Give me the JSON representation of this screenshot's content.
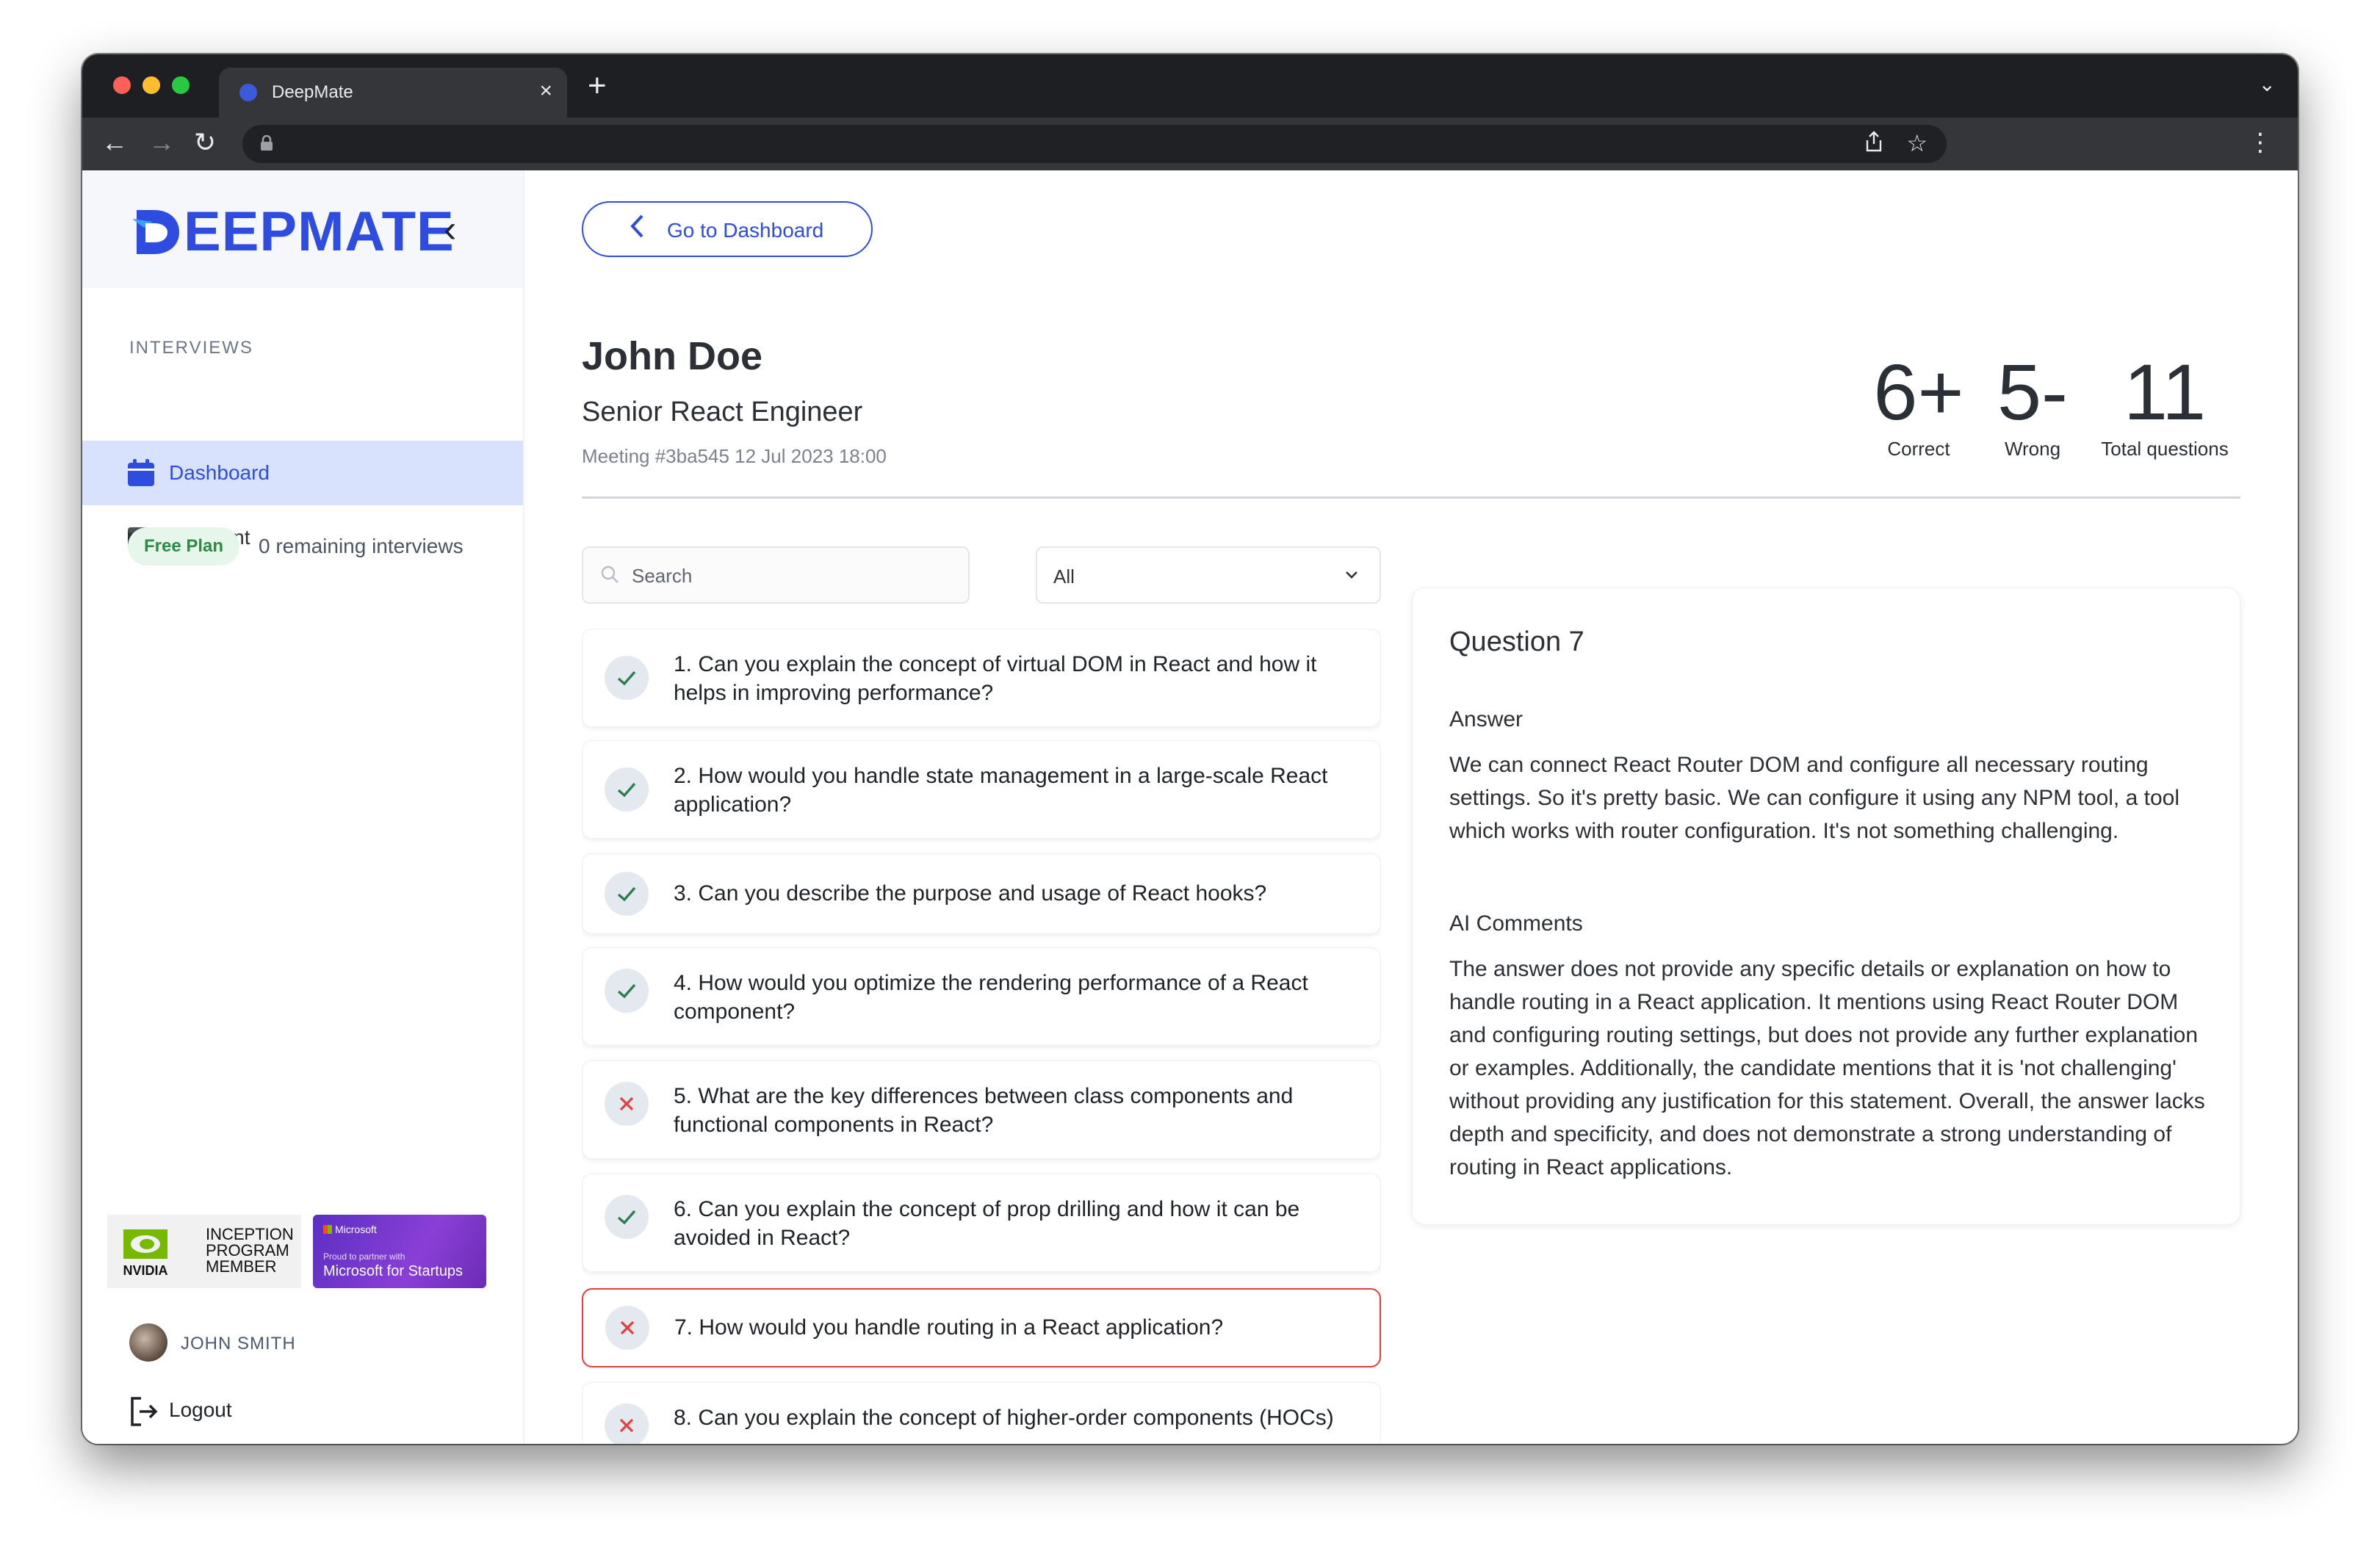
{
  "browser": {
    "tab_title": "DeepMate",
    "tab_close": "×",
    "new_tab": "+",
    "tab_menu": "⌄"
  },
  "icons": {
    "back": "←",
    "forward": "→",
    "reload": "↻",
    "lock": "🔒",
    "share": "⇪",
    "star": "☆",
    "kebab": "⋮",
    "collapse": "‹",
    "chevron_left": "‹"
  },
  "sidebar": {
    "logo": "EEPMATE",
    "section_label": "INTERVIEWS",
    "items": [
      {
        "label": "Dashboard",
        "active": true
      },
      {
        "label": "Payment",
        "active": false
      }
    ],
    "plan_badge": "Free Plan",
    "remaining": "0 remaining interviews",
    "partners": {
      "nvidia_text": [
        "INCEPTION",
        "PROGRAM",
        "MEMBER"
      ],
      "nvidia_brand": "NVIDIA",
      "ms_brand": "Microsoft",
      "ms_line": "Proud to partner with",
      "ms_program": "Microsoft for Startups"
    },
    "user_name": "JOHN SMITH",
    "logout": "Logout"
  },
  "main": {
    "back_button": "Go to Dashboard",
    "candidate": {
      "name": "John Doe",
      "role": "Senior React Engineer",
      "meeting": "Meeting #3ba545 12 Jul 2023 18:00"
    },
    "stats": [
      {
        "value": "6+",
        "label": "Correct"
      },
      {
        "value": "5-",
        "label": "Wrong"
      },
      {
        "value": "11",
        "label": "Total questions"
      }
    ],
    "search_placeholder": "Search",
    "filter_value": "All",
    "questions": [
      {
        "text": "1. Can you explain the concept of virtual DOM in React and how it helps in improving performance?",
        "status": "correct"
      },
      {
        "text": "2. How would you handle state management in a large-scale React application?",
        "status": "correct"
      },
      {
        "text": "3. Can you describe the purpose and usage of React hooks?",
        "status": "correct"
      },
      {
        "text": "4. How would you optimize the rendering performance of a React component?",
        "status": "correct"
      },
      {
        "text": "5. What are the key differences between class components and functional components in React?",
        "status": "wrong"
      },
      {
        "text": "6. Can you explain the concept of prop drilling and how it can be avoided in React?",
        "status": "correct"
      },
      {
        "text": "7. How would you handle routing in a React application?",
        "status": "wrong",
        "selected": true
      },
      {
        "text": "8. Can you explain the concept of higher-order components (HOCs)",
        "status": "wrong"
      }
    ],
    "detail": {
      "title": "Question 7",
      "answer_label": "Answer",
      "answer": "We can connect React Router DOM and configure all necessary routing settings. So it's pretty basic. We can configure it using any NPM tool, a tool which works with router configuration. It's not something challenging.",
      "comments_label": "AI Comments",
      "comments": "The answer does not provide any specific details or explanation on how to handle routing in a React application. It mentions using React Router DOM and configuring routing settings, but does not provide any further explanation or examples. Additionally, the candidate mentions that it is 'not challenging' without providing any justification for this statement. Overall, the answer lacks depth and specificity, and does not demonstrate a strong understanding of routing in React applications."
    }
  },
  "colors": {
    "accent": "#2f4ce0",
    "active_bg": "#d9e2fd",
    "correct": "#2e7d4f",
    "wrong": "#e53e3e"
  }
}
